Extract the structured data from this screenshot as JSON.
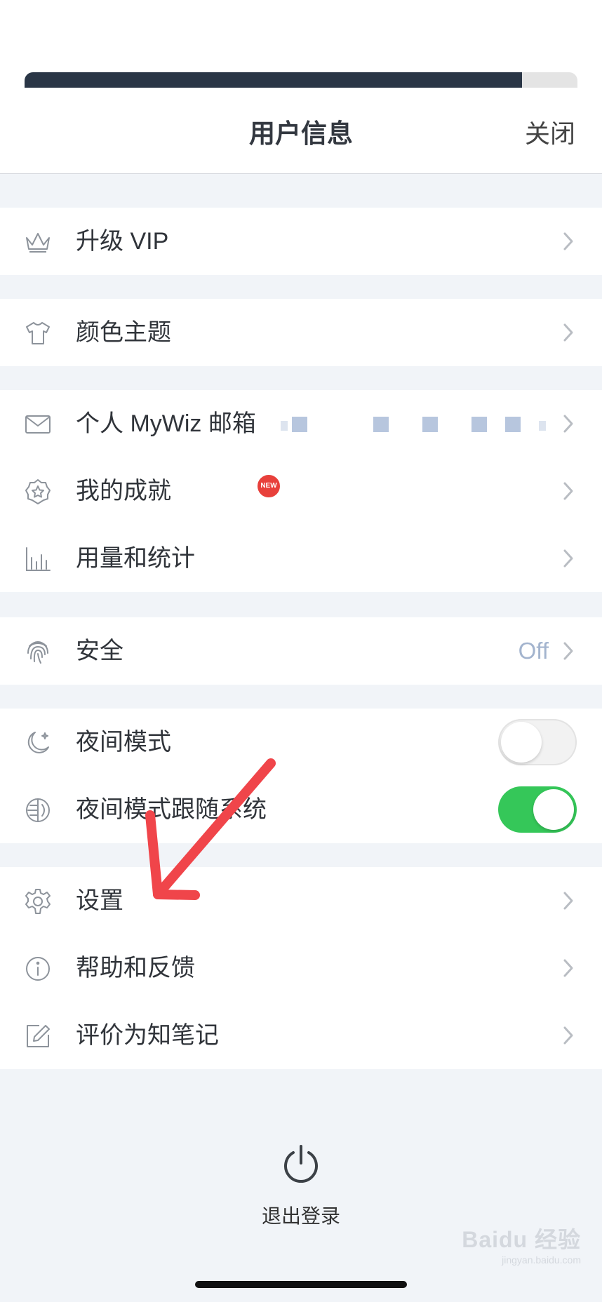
{
  "progress": {
    "fraction": 0.9
  },
  "header": {
    "title": "用户信息",
    "close_label": "关闭"
  },
  "groups": {
    "vip": {
      "upgrade_label": "升级 VIP"
    },
    "theme": {
      "color_theme_label": "颜色主题"
    },
    "account": {
      "mail_label": "个人 MyWiz 邮箱",
      "achievements_label": "我的成就",
      "new_badge": "NEW",
      "usage_label": "用量和统计"
    },
    "security": {
      "label": "安全",
      "value": "Off"
    },
    "night": {
      "night_mode_label": "夜间模式",
      "night_mode_on": false,
      "follow_system_label": "夜间模式跟随系统",
      "follow_system_on": true
    },
    "misc": {
      "settings_label": "设置",
      "help_label": "帮助和反馈",
      "rate_label": "评价为知笔记"
    }
  },
  "logout": {
    "label": "退出登录"
  },
  "watermark": {
    "brand": "Baidu 经验",
    "url": "jingyan.baidu.com"
  },
  "colors": {
    "progress_fill": "#2a3646",
    "toggle_on": "#35c759",
    "badge": "#e8403b",
    "annotation_arrow": "#f0454a",
    "secondary_value": "#a3b4ce"
  }
}
